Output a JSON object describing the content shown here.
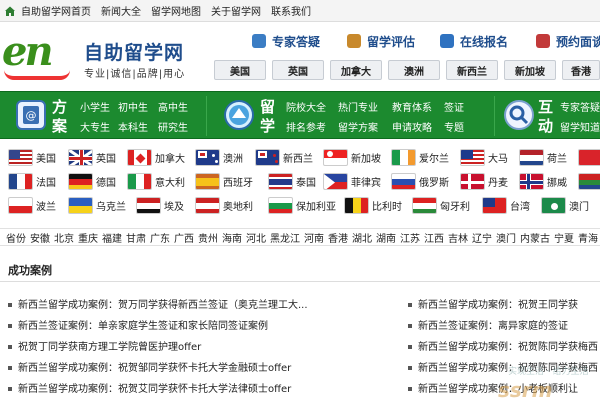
{
  "topnav": {
    "items": [
      "自助留学网首页",
      "新闻大全",
      "留学网地图",
      "关于留学网",
      "联系我们"
    ]
  },
  "logo": {
    "mark": "en",
    "site_name": "自助留学网",
    "slogan": "专业|诚信|品牌|用心"
  },
  "quick_links": [
    {
      "label": "专家答疑",
      "icon": "chat-bubble-icon",
      "color": "#3b7dc4"
    },
    {
      "label": "留学评估",
      "icon": "assessment-icon",
      "color": "#c8892c"
    },
    {
      "label": "在线报名",
      "icon": "monitor-icon",
      "color": "#2f72c0"
    },
    {
      "label": "预约面谈",
      "icon": "appointment-icon",
      "color": "#c23a3a"
    }
  ],
  "country_tabs": [
    "美国",
    "英国",
    "加拿大",
    "澳洲",
    "新西兰",
    "新加坡",
    "香港"
  ],
  "green_bar": {
    "section1": {
      "title": [
        "方",
        "案"
      ],
      "row1": [
        "小学生",
        "初中生",
        "高中生"
      ],
      "row2": [
        "大专生",
        "本科生",
        "研究生"
      ]
    },
    "section2": {
      "title": [
        "留",
        "学"
      ],
      "row1": [
        "院校大全",
        "热门专业",
        "教育体系",
        "签证"
      ],
      "row2": [
        "排名参考",
        "留学方案",
        "申请攻略",
        "专题"
      ]
    },
    "section3": {
      "title": [
        "互",
        "动"
      ],
      "row1": [
        "专家答疑"
      ],
      "row2": [
        "留学知道"
      ]
    }
  },
  "countries_row1": [
    {
      "name": "美国",
      "flag": "us"
    },
    {
      "name": "英国",
      "flag": "gb"
    },
    {
      "name": "加拿大",
      "flag": "ca"
    },
    {
      "name": "澳洲",
      "flag": "au"
    },
    {
      "name": "新西兰",
      "flag": "nz"
    },
    {
      "name": "新加坡",
      "flag": "sg"
    },
    {
      "name": "爱尔兰",
      "flag": "ie"
    },
    {
      "name": "大马",
      "flag": "my"
    },
    {
      "name": "荷兰",
      "flag": "nl"
    }
  ],
  "countries_row2": [
    {
      "name": "法国",
      "flag": "fr"
    },
    {
      "name": "德国",
      "flag": "de"
    },
    {
      "name": "意大利",
      "flag": "it"
    },
    {
      "name": "西班牙",
      "flag": "es"
    },
    {
      "name": "泰国",
      "flag": "th"
    },
    {
      "name": "菲律宾",
      "flag": "ph"
    },
    {
      "name": "俄罗斯",
      "flag": "ru"
    },
    {
      "name": "丹麦",
      "flag": "dk"
    },
    {
      "name": "挪威",
      "flag": "no"
    }
  ],
  "countries_row3": [
    {
      "name": "波兰",
      "flag": "pl"
    },
    {
      "name": "乌克兰",
      "flag": "ua"
    },
    {
      "name": "埃及",
      "flag": "eg"
    },
    {
      "name": "奥地利",
      "flag": "at"
    },
    {
      "name": "保加利亚",
      "flag": "bg"
    },
    {
      "name": "比利时",
      "flag": "be"
    },
    {
      "name": "匈牙利",
      "flag": "hu"
    },
    {
      "name": "台湾",
      "flag": "tw"
    },
    {
      "name": "澳门",
      "flag": "mo"
    }
  ],
  "provinces": [
    "省份",
    "安徽",
    "北京",
    "重庆",
    "福建",
    "甘肃",
    "广东",
    "广西",
    "贵州",
    "海南",
    "河北",
    "黑龙江",
    "河南",
    "香港",
    "湖北",
    "湖南",
    "江苏",
    "江西",
    "吉林",
    "辽宁",
    "澳门",
    "内蒙古",
    "宁夏",
    "青海",
    "山东"
  ],
  "cases": {
    "title": "成功案例",
    "left": [
      "新西兰留学成功案例：贺万同学获得新西兰签证（奥克兰理工大...",
      "新西兰签证案例：单亲家庭学生签证和家长陪同签证案例",
      "祝贺丁同学获南方理工学院曾医护理offer",
      "新西兰留学成功案例：祝贺邹同学获怀卡托大学金融硕士offer",
      "新西兰留学成功案例：祝贺艾同学获怀卡托大学法律硕士offer"
    ],
    "right": [
      "新西兰留学成功案例：祝贺王同学获",
      "新西兰签证案例：离异家庭的签证",
      "新西兰留学成功案例：祝贺陈同学获梅西",
      "新西兰留学成功案例：祝贺陈同学获梅西",
      "新西兰留学成功案例：小老板顺利让"
    ]
  },
  "watermark": {
    "text": "实现生活 · 给力生活",
    "brand": "ssrm"
  }
}
